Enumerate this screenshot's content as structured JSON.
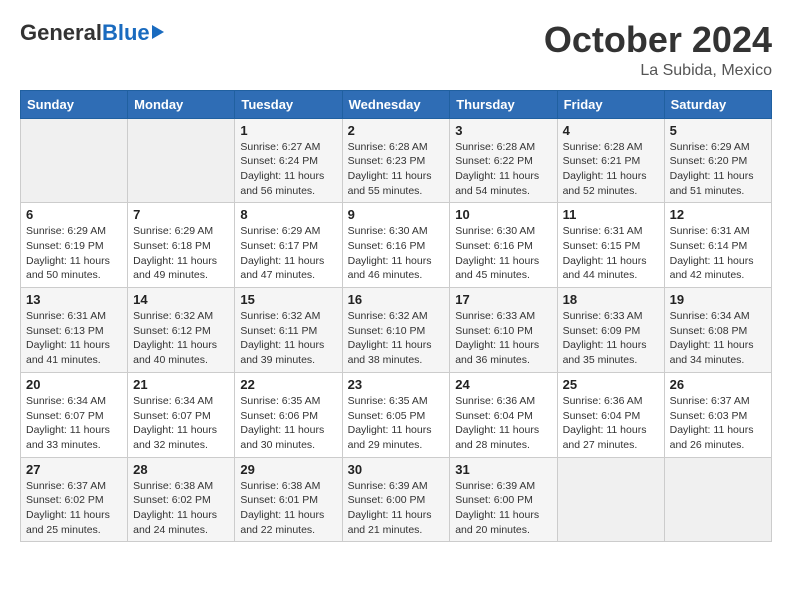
{
  "logo": {
    "general": "General",
    "blue": "Blue"
  },
  "header": {
    "month": "October 2024",
    "location": "La Subida, Mexico"
  },
  "weekdays": [
    "Sunday",
    "Monday",
    "Tuesday",
    "Wednesday",
    "Thursday",
    "Friday",
    "Saturday"
  ],
  "weeks": [
    [
      {
        "day": "",
        "sunrise": "",
        "sunset": "",
        "daylight": ""
      },
      {
        "day": "",
        "sunrise": "",
        "sunset": "",
        "daylight": ""
      },
      {
        "day": "1",
        "sunrise": "Sunrise: 6:27 AM",
        "sunset": "Sunset: 6:24 PM",
        "daylight": "Daylight: 11 hours and 56 minutes."
      },
      {
        "day": "2",
        "sunrise": "Sunrise: 6:28 AM",
        "sunset": "Sunset: 6:23 PM",
        "daylight": "Daylight: 11 hours and 55 minutes."
      },
      {
        "day": "3",
        "sunrise": "Sunrise: 6:28 AM",
        "sunset": "Sunset: 6:22 PM",
        "daylight": "Daylight: 11 hours and 54 minutes."
      },
      {
        "day": "4",
        "sunrise": "Sunrise: 6:28 AM",
        "sunset": "Sunset: 6:21 PM",
        "daylight": "Daylight: 11 hours and 52 minutes."
      },
      {
        "day": "5",
        "sunrise": "Sunrise: 6:29 AM",
        "sunset": "Sunset: 6:20 PM",
        "daylight": "Daylight: 11 hours and 51 minutes."
      }
    ],
    [
      {
        "day": "6",
        "sunrise": "Sunrise: 6:29 AM",
        "sunset": "Sunset: 6:19 PM",
        "daylight": "Daylight: 11 hours and 50 minutes."
      },
      {
        "day": "7",
        "sunrise": "Sunrise: 6:29 AM",
        "sunset": "Sunset: 6:18 PM",
        "daylight": "Daylight: 11 hours and 49 minutes."
      },
      {
        "day": "8",
        "sunrise": "Sunrise: 6:29 AM",
        "sunset": "Sunset: 6:17 PM",
        "daylight": "Daylight: 11 hours and 47 minutes."
      },
      {
        "day": "9",
        "sunrise": "Sunrise: 6:30 AM",
        "sunset": "Sunset: 6:16 PM",
        "daylight": "Daylight: 11 hours and 46 minutes."
      },
      {
        "day": "10",
        "sunrise": "Sunrise: 6:30 AM",
        "sunset": "Sunset: 6:16 PM",
        "daylight": "Daylight: 11 hours and 45 minutes."
      },
      {
        "day": "11",
        "sunrise": "Sunrise: 6:31 AM",
        "sunset": "Sunset: 6:15 PM",
        "daylight": "Daylight: 11 hours and 44 minutes."
      },
      {
        "day": "12",
        "sunrise": "Sunrise: 6:31 AM",
        "sunset": "Sunset: 6:14 PM",
        "daylight": "Daylight: 11 hours and 42 minutes."
      }
    ],
    [
      {
        "day": "13",
        "sunrise": "Sunrise: 6:31 AM",
        "sunset": "Sunset: 6:13 PM",
        "daylight": "Daylight: 11 hours and 41 minutes."
      },
      {
        "day": "14",
        "sunrise": "Sunrise: 6:32 AM",
        "sunset": "Sunset: 6:12 PM",
        "daylight": "Daylight: 11 hours and 40 minutes."
      },
      {
        "day": "15",
        "sunrise": "Sunrise: 6:32 AM",
        "sunset": "Sunset: 6:11 PM",
        "daylight": "Daylight: 11 hours and 39 minutes."
      },
      {
        "day": "16",
        "sunrise": "Sunrise: 6:32 AM",
        "sunset": "Sunset: 6:10 PM",
        "daylight": "Daylight: 11 hours and 38 minutes."
      },
      {
        "day": "17",
        "sunrise": "Sunrise: 6:33 AM",
        "sunset": "Sunset: 6:10 PM",
        "daylight": "Daylight: 11 hours and 36 minutes."
      },
      {
        "day": "18",
        "sunrise": "Sunrise: 6:33 AM",
        "sunset": "Sunset: 6:09 PM",
        "daylight": "Daylight: 11 hours and 35 minutes."
      },
      {
        "day": "19",
        "sunrise": "Sunrise: 6:34 AM",
        "sunset": "Sunset: 6:08 PM",
        "daylight": "Daylight: 11 hours and 34 minutes."
      }
    ],
    [
      {
        "day": "20",
        "sunrise": "Sunrise: 6:34 AM",
        "sunset": "Sunset: 6:07 PM",
        "daylight": "Daylight: 11 hours and 33 minutes."
      },
      {
        "day": "21",
        "sunrise": "Sunrise: 6:34 AM",
        "sunset": "Sunset: 6:07 PM",
        "daylight": "Daylight: 11 hours and 32 minutes."
      },
      {
        "day": "22",
        "sunrise": "Sunrise: 6:35 AM",
        "sunset": "Sunset: 6:06 PM",
        "daylight": "Daylight: 11 hours and 30 minutes."
      },
      {
        "day": "23",
        "sunrise": "Sunrise: 6:35 AM",
        "sunset": "Sunset: 6:05 PM",
        "daylight": "Daylight: 11 hours and 29 minutes."
      },
      {
        "day": "24",
        "sunrise": "Sunrise: 6:36 AM",
        "sunset": "Sunset: 6:04 PM",
        "daylight": "Daylight: 11 hours and 28 minutes."
      },
      {
        "day": "25",
        "sunrise": "Sunrise: 6:36 AM",
        "sunset": "Sunset: 6:04 PM",
        "daylight": "Daylight: 11 hours and 27 minutes."
      },
      {
        "day": "26",
        "sunrise": "Sunrise: 6:37 AM",
        "sunset": "Sunset: 6:03 PM",
        "daylight": "Daylight: 11 hours and 26 minutes."
      }
    ],
    [
      {
        "day": "27",
        "sunrise": "Sunrise: 6:37 AM",
        "sunset": "Sunset: 6:02 PM",
        "daylight": "Daylight: 11 hours and 25 minutes."
      },
      {
        "day": "28",
        "sunrise": "Sunrise: 6:38 AM",
        "sunset": "Sunset: 6:02 PM",
        "daylight": "Daylight: 11 hours and 24 minutes."
      },
      {
        "day": "29",
        "sunrise": "Sunrise: 6:38 AM",
        "sunset": "Sunset: 6:01 PM",
        "daylight": "Daylight: 11 hours and 22 minutes."
      },
      {
        "day": "30",
        "sunrise": "Sunrise: 6:39 AM",
        "sunset": "Sunset: 6:00 PM",
        "daylight": "Daylight: 11 hours and 21 minutes."
      },
      {
        "day": "31",
        "sunrise": "Sunrise: 6:39 AM",
        "sunset": "Sunset: 6:00 PM",
        "daylight": "Daylight: 11 hours and 20 minutes."
      },
      {
        "day": "",
        "sunrise": "",
        "sunset": "",
        "daylight": ""
      },
      {
        "day": "",
        "sunrise": "",
        "sunset": "",
        "daylight": ""
      }
    ]
  ]
}
